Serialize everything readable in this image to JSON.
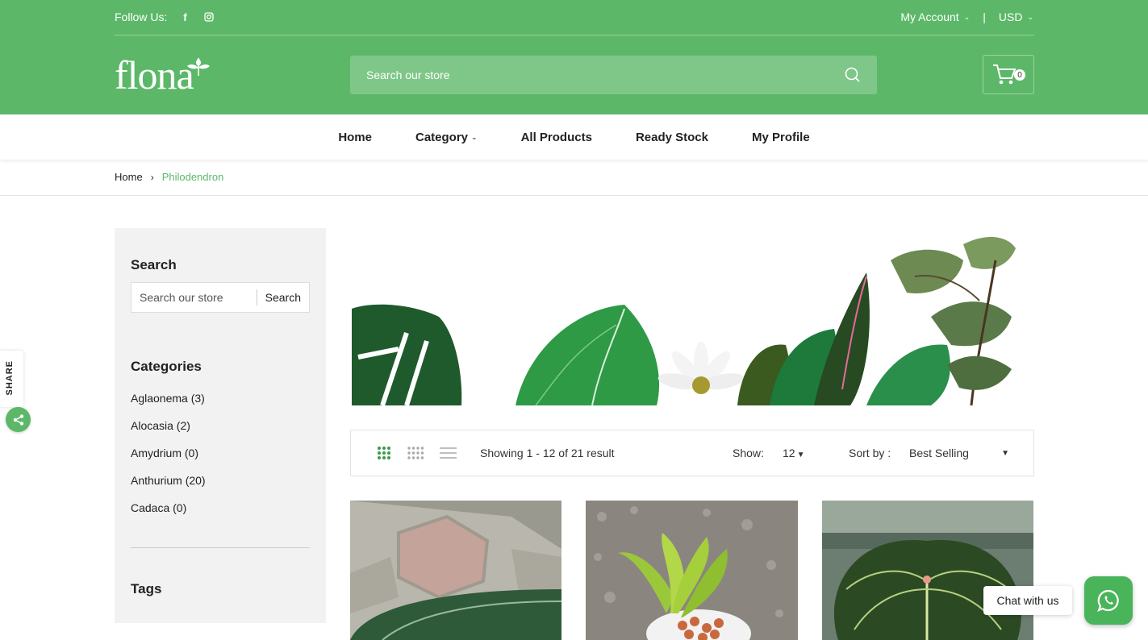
{
  "topbar": {
    "follow_label": "Follow Us:",
    "social_icons": [
      "facebook-icon",
      "instagram-icon"
    ],
    "account_label": "My Account",
    "separator": "|",
    "currency": "USD"
  },
  "header": {
    "logo_text": "flona",
    "search_placeholder": "Search our store",
    "cart_count": "0"
  },
  "nav": {
    "items": [
      {
        "label": "Home"
      },
      {
        "label": "Category"
      },
      {
        "label": "All Products"
      },
      {
        "label": "Ready Stock"
      },
      {
        "label": "My Profile"
      }
    ]
  },
  "breadcrumb": {
    "home": "Home",
    "current": "Philodendron"
  },
  "sidebar": {
    "search_title": "Search",
    "search_placeholder": "Search our store",
    "search_button": "Search",
    "categories_title": "Categories",
    "categories": [
      {
        "label": "Aglaonema (3)"
      },
      {
        "label": "Alocasia (2)"
      },
      {
        "label": "Amydrium (0)"
      },
      {
        "label": "Anthurium (20)"
      },
      {
        "label": "Cadaca (0)"
      }
    ],
    "tags_title": "Tags"
  },
  "toolbar": {
    "showing": "Showing 1 - 12 of 21 result",
    "show_label": "Show:",
    "show_value": "12",
    "sort_label": "Sort by :",
    "sort_value": "Best Selling"
  },
  "floating": {
    "share_label": "SHARE",
    "chat_label": "Chat with us"
  },
  "colors": {
    "brand_green": "#5cb868",
    "whatsapp_green": "#4ab45b"
  }
}
